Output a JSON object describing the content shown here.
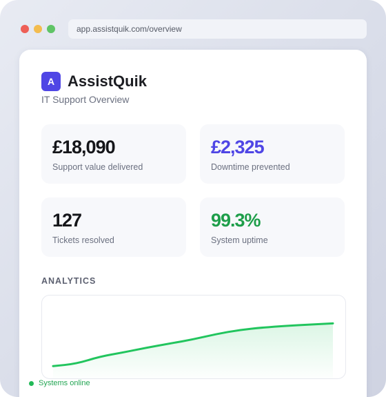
{
  "browser": {
    "url": "app.assistquik.com/overview"
  },
  "brand": {
    "logo_letter": "A",
    "name": "AssistQuik",
    "subtitle": "IT Support Overview"
  },
  "metrics": [
    {
      "value": "£18,090",
      "label": "Support value delivered",
      "color": "#15161a"
    },
    {
      "value": "£2,325",
      "label": "Downtime prevented",
      "color": "#4f46e5"
    },
    {
      "value": "127",
      "label": "Tickets resolved",
      "color": "#15161a"
    },
    {
      "value": "99.3%",
      "label": "System uptime",
      "color": "#1e9e4a"
    }
  ],
  "analytics": {
    "title": "ANALYTICS"
  },
  "chart_data": {
    "type": "area",
    "x": [
      0,
      1,
      2,
      3,
      4,
      5,
      6,
      7,
      8,
      9,
      10,
      11,
      12
    ],
    "series": [
      {
        "values": [
          2,
          6,
          18,
          25,
          33,
          40,
          47,
          56,
          63,
          67,
          70,
          72,
          74
        ]
      }
    ],
    "ylim": [
      0,
      100
    ],
    "grid": false,
    "color": "#22c55e"
  },
  "status": {
    "label": "Systems online",
    "color": "#22b957"
  }
}
